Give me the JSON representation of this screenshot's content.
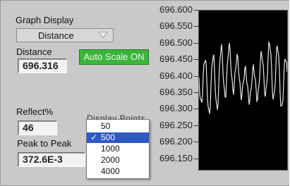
{
  "graph_display": {
    "label": "Graph Display",
    "selected": "Distance"
  },
  "distance": {
    "label": "Distance",
    "value": "696.316"
  },
  "auto_scale": {
    "label": "Auto Scale ON",
    "color": "#3ab63a"
  },
  "reflect": {
    "label": "Reflect%",
    "value": "46"
  },
  "peak_to_peak": {
    "label": "Peak to Peak",
    "value": "372.6E-3"
  },
  "obscured_label": "Display Points",
  "dropdown": {
    "options": [
      "50",
      "500",
      "1000",
      "2000",
      "4000"
    ],
    "selected": "500",
    "check_mark": "✓"
  },
  "graph": {
    "y_ticks": [
      "696.600",
      "696.550",
      "696.500",
      "696.450",
      "696.400",
      "696.350",
      "696.300",
      "696.250",
      "696.200",
      "696.150"
    ],
    "background": "#000000",
    "trace_color": "#e6e6e6"
  }
}
